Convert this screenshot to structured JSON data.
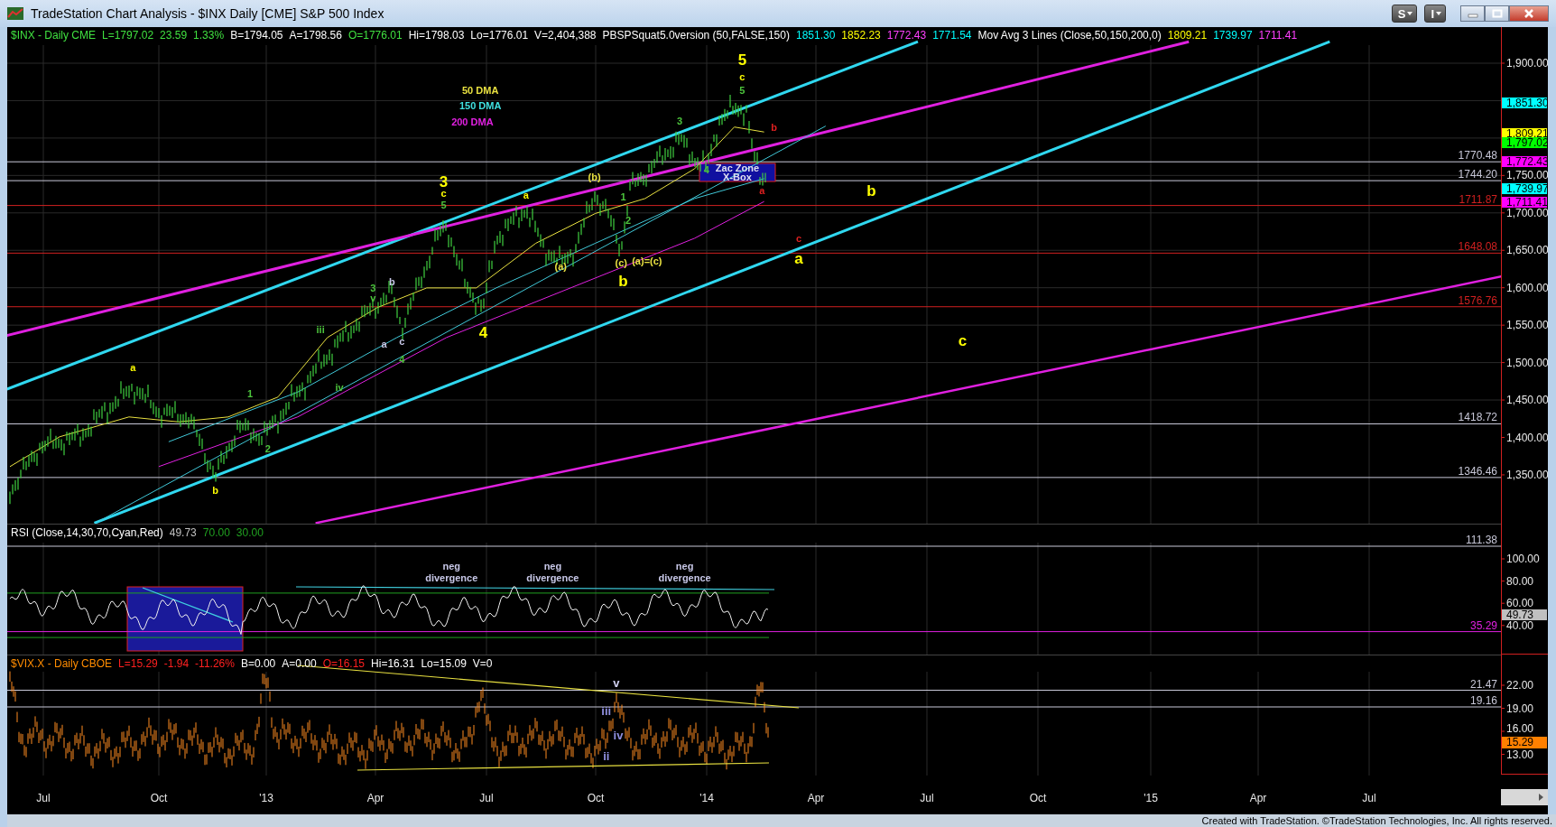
{
  "window": {
    "title": "TradeStation Chart Analysis - $INX Daily [CME] S&P 500 Index",
    "menu_buttons": [
      {
        "label": "S"
      },
      {
        "label": "I"
      }
    ]
  },
  "price_panel": {
    "legend": [
      {
        "text": "$INX - Daily  CME",
        "color": "#40e040"
      },
      {
        "text": "L=1797.02",
        "color": "#40e040"
      },
      {
        "text": "23.59",
        "color": "#40e040"
      },
      {
        "text": "1.33%",
        "color": "#40e040"
      },
      {
        "text": "B=1794.05",
        "color": "#ffffff"
      },
      {
        "text": "A=1798.56",
        "color": "#ffffff"
      },
      {
        "text": "O=1776.01",
        "color": "#40e040"
      },
      {
        "text": "Hi=1798.03",
        "color": "#ffffff"
      },
      {
        "text": "Lo=1776.01",
        "color": "#ffffff"
      },
      {
        "text": "V=2,404,388",
        "color": "#ffffff"
      },
      {
        "text": "PBSPSquat5.0version (50,FALSE,150)",
        "color": "#ffffff"
      },
      {
        "text": "1851.30",
        "color": "#00ffff"
      },
      {
        "text": "1852.23",
        "color": "#ffff00"
      },
      {
        "text": "1772.43",
        "color": "#ff40ff"
      },
      {
        "text": "1771.54",
        "color": "#00ffff"
      },
      {
        "text": "Mov Avg 3 Lines (Close,50,150,200,0)",
        "color": "#ffffff"
      },
      {
        "text": "1809.21",
        "color": "#ffff00"
      },
      {
        "text": "1739.97",
        "color": "#00ffff"
      },
      {
        "text": "1711.41",
        "color": "#ff40ff"
      }
    ],
    "levels": [
      {
        "label": "1770.48",
        "color": "#c8c8d8"
      },
      {
        "label": "1744.20",
        "color": "#c8c8d8"
      },
      {
        "label": "1711.87",
        "color": "#d02020"
      },
      {
        "label": "1648.08",
        "color": "#d02020"
      },
      {
        "label": "1576.76",
        "color": "#d02020"
      },
      {
        "label": "1418.72",
        "color": "#c8c8d8"
      },
      {
        "label": "1346.46",
        "color": "#c8c8d8"
      }
    ],
    "zone": {
      "lines": [
        "Zac Zone",
        "X-Box"
      ]
    },
    "annotations": [
      {
        "text": "5",
        "color": "#ffff00",
        "kind": "large"
      },
      {
        "text": "c",
        "color": "#ffff00",
        "kind": "small"
      },
      {
        "text": "50 DMA",
        "color": "#e8e040",
        "kind": "small"
      },
      {
        "text": "5",
        "color": "#4cc43c",
        "kind": "small"
      },
      {
        "text": "150 DMA",
        "color": "#40e0e0",
        "kind": "small"
      },
      {
        "text": "200 DMA",
        "color": "#e020e0",
        "kind": "small"
      },
      {
        "text": "3",
        "color": "#4cc43c",
        "kind": "small"
      },
      {
        "text": "b",
        "color": "#e02020",
        "kind": "small"
      },
      {
        "text": "3",
        "color": "#ffff00",
        "kind": "large"
      },
      {
        "text": "(b)",
        "color": "#e8e040",
        "kind": "small"
      },
      {
        "text": "4",
        "color": "#4cc43c",
        "kind": "small"
      },
      {
        "text": "c",
        "color": "#ffff00",
        "kind": "small"
      },
      {
        "text": "a",
        "color": "#ffff00",
        "kind": "small"
      },
      {
        "text": "1",
        "color": "#4cc43c",
        "kind": "small"
      },
      {
        "text": "a",
        "color": "#e02020",
        "kind": "small"
      },
      {
        "text": "b",
        "color": "#ffff00",
        "kind": "large"
      },
      {
        "text": "5",
        "color": "#4cc43c",
        "kind": "small"
      },
      {
        "text": "2",
        "color": "#4cc43c",
        "kind": "small"
      },
      {
        "text": "c",
        "color": "#e02020",
        "kind": "small"
      },
      {
        "text": "(a)",
        "color": "#e8e040",
        "kind": "small"
      },
      {
        "text": "(c)",
        "color": "#e8e040",
        "kind": "small"
      },
      {
        "text": "(a)=(c)",
        "color": "#e8e040",
        "kind": "small"
      },
      {
        "text": "a",
        "color": "#ffff00",
        "kind": "large"
      },
      {
        "text": "3",
        "color": "#4cc43c",
        "kind": "small"
      },
      {
        "text": "b",
        "color": "#c8c8e8",
        "kind": "small"
      },
      {
        "text": "b",
        "color": "#ffff00",
        "kind": "large"
      },
      {
        "text": "v",
        "color": "#4cc43c",
        "kind": "small"
      },
      {
        "text": "iii",
        "color": "#4cc43c",
        "kind": "small"
      },
      {
        "text": "a",
        "color": "#c8c8e8",
        "kind": "small"
      },
      {
        "text": "c",
        "color": "#c8c8e8",
        "kind": "small"
      },
      {
        "text": "4",
        "color": "#ffff00",
        "kind": "large"
      },
      {
        "text": "c",
        "color": "#ffff00",
        "kind": "large"
      },
      {
        "text": "4",
        "color": "#4cc43c",
        "kind": "small"
      },
      {
        "text": "a",
        "color": "#ffff00",
        "kind": "small"
      },
      {
        "text": "1",
        "color": "#4cc43c",
        "kind": "small"
      },
      {
        "text": "iv",
        "color": "#4cc43c",
        "kind": "small"
      },
      {
        "text": "2",
        "color": "#4cc43c",
        "kind": "small"
      },
      {
        "text": "b",
        "color": "#ffff00",
        "kind": "small"
      }
    ],
    "axis_labels": [
      "1,900.00",
      "1,750.00",
      "1,700.00",
      "1,650.00",
      "1,600.00",
      "1,550.00",
      "1,500.00",
      "1,450.00",
      "1,400.00",
      "1,350.00"
    ],
    "price_tags": [
      {
        "label": "1,851.30",
        "color": "#00ffff"
      },
      {
        "label": "1,809.21",
        "color": "#ffff00"
      },
      {
        "label": "1,797.02",
        "color": "#00ff00"
      },
      {
        "label": "1,772.43",
        "color": "#ff00ff"
      },
      {
        "label": "1,739.97",
        "color": "#00ffff"
      },
      {
        "label": "1,711.41",
        "color": "#ff00ff"
      }
    ]
  },
  "rsi_panel": {
    "legend": [
      {
        "text": "RSI (Close,14,30,70,Cyan,Red)",
        "color": "#ffffff"
      },
      {
        "text": "49.73",
        "color": "#c0c0c0"
      },
      {
        "text": "70.00",
        "color": "#20a020"
      },
      {
        "text": "30.00",
        "color": "#20a020"
      }
    ],
    "levels": [
      {
        "label": "111.38",
        "color": "#c8c8d8"
      },
      {
        "label": "35.29",
        "color": "#e020e0"
      }
    ],
    "annotations": [
      {
        "text": "neg",
        "color": "#c8c8e8",
        "kind": "small"
      },
      {
        "text": "neg",
        "color": "#c8c8e8",
        "kind": "small"
      },
      {
        "text": "neg",
        "color": "#c8c8e8",
        "kind": "small"
      },
      {
        "text": "divergence",
        "color": "#c8c8e8",
        "kind": "small"
      },
      {
        "text": "divergence",
        "color": "#c8c8e8",
        "kind": "small"
      },
      {
        "text": "divergence",
        "color": "#c8c8e8",
        "kind": "small"
      }
    ],
    "axis_labels": [
      "100.00",
      "80.00",
      "60.00",
      "40.00"
    ],
    "price_tags": [
      {
        "label": "49.73",
        "color": "#c0c0c0"
      }
    ]
  },
  "vix_panel": {
    "legend": [
      {
        "text": "$VIX.X - Daily  CBOE",
        "color": "#ff8c00"
      },
      {
        "text": "L=15.29",
        "color": "#ff2020"
      },
      {
        "text": "-1.94",
        "color": "#ff2020"
      },
      {
        "text": "-11.26%",
        "color": "#ff2020"
      },
      {
        "text": "B=0.00",
        "color": "#ffffff"
      },
      {
        "text": "A=0.00",
        "color": "#ffffff"
      },
      {
        "text": "O=16.15",
        "color": "#ff2020"
      },
      {
        "text": "Hi=16.31",
        "color": "#ffffff"
      },
      {
        "text": "Lo=15.09",
        "color": "#ffffff"
      },
      {
        "text": "V=0",
        "color": "#ffffff"
      }
    ],
    "levels": [
      {
        "label": "21.47",
        "color": "#c8c8d8"
      },
      {
        "label": "19.16",
        "color": "#c8c8d8"
      }
    ],
    "annotations": [
      {
        "text": "v",
        "color": "#d0d0f0",
        "kind": "small"
      },
      {
        "text": "iii",
        "color": "#9090e0",
        "kind": "small"
      },
      {
        "text": "iv",
        "color": "#9090e0",
        "kind": "small"
      },
      {
        "text": "ii",
        "color": "#9090e0",
        "kind": "small"
      }
    ],
    "axis_labels": [
      "22.00",
      "19.00",
      "16.00",
      "13.00"
    ],
    "price_tags": [
      {
        "label": "15.29",
        "color": "#ff8000"
      }
    ]
  },
  "x_axis": {
    "labels": [
      "Jul",
      "Oct",
      "'13",
      "Apr",
      "Jul",
      "Oct",
      "'14",
      "Apr",
      "Jul",
      "Oct",
      "'15",
      "Apr",
      "Jul"
    ]
  },
  "footer": "Created with TradeStation. ©TradeStation Technologies, Inc. All rights reserved."
}
